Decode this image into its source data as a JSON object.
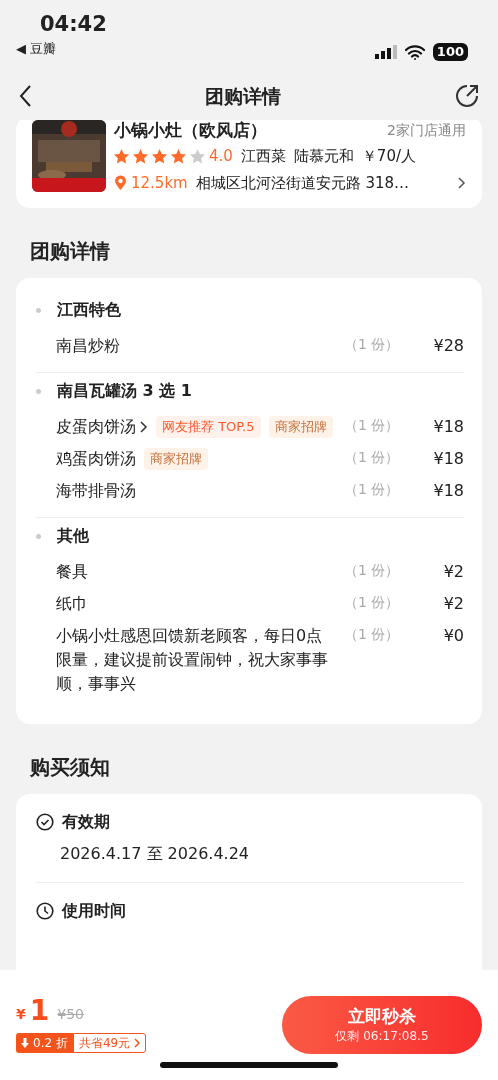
{
  "status_bar": {
    "time": "04:42",
    "back_glyph": "◀",
    "back_app": "豆瓣",
    "battery": "100"
  },
  "header": {
    "title": "团购详情"
  },
  "shop": {
    "name": "小锅小灶（欧风店）",
    "branches": "2家门店通用",
    "stars": 4,
    "rating": "4.0",
    "cuisine": "江西菜",
    "area": "陆慕元和",
    "price": "￥70/人",
    "distance": "12.5km",
    "address": "相城区北河泾街道安元路 318…"
  },
  "deal": {
    "title": "团购详情",
    "groups": [
      {
        "title": "江西特色",
        "items": [
          {
            "name": "南昌炒粉",
            "link": false,
            "qty": "（1 份）",
            "price": "¥28"
          }
        ]
      },
      {
        "title": "南昌瓦罐汤 3 选 1",
        "items": [
          {
            "name": "皮蛋肉饼汤",
            "link": true,
            "tags": [
              {
                "kind": "ranking",
                "text": "网友推荐 TOP.5"
              },
              {
                "kind": "signature",
                "text": "商家招牌"
              }
            ],
            "qty": "（1 份）",
            "price": "¥18"
          },
          {
            "name": "鸡蛋肉饼汤",
            "link": false,
            "tags": [
              {
                "kind": "signature",
                "text": "商家招牌"
              }
            ],
            "qty": "（1 份）",
            "price": "¥18"
          },
          {
            "name": "海带排骨汤",
            "link": false,
            "qty": "（1 份）",
            "price": "¥18"
          }
        ]
      },
      {
        "title": "其他",
        "items": [
          {
            "name": "餐具",
            "link": false,
            "qty": "（1 份）",
            "price": "¥2"
          },
          {
            "name": "纸巾",
            "link": false,
            "qty": "（1 份）",
            "price": "¥2"
          },
          {
            "name": "小锅小灶感恩回馈新老顾客，每日0点限量，建议提前设置闹钟，祝大家事事顺，事事兴",
            "link": false,
            "qty": "（1 份）",
            "price": "¥0"
          }
        ]
      }
    ]
  },
  "notice": {
    "title": "购买须知",
    "items": [
      {
        "kind": "validity",
        "title": "有效期",
        "text": "2026.4.17 至 2026.4.24"
      },
      {
        "kind": "time",
        "title": "使用时间"
      }
    ]
  },
  "bottom_bar": {
    "currency": "¥",
    "price": "1",
    "original_price": "¥50",
    "discount": "0.2 折",
    "savings": "共省49元",
    "button": "立即秒杀",
    "countdown": "仅剩 06:17:08.5"
  }
}
